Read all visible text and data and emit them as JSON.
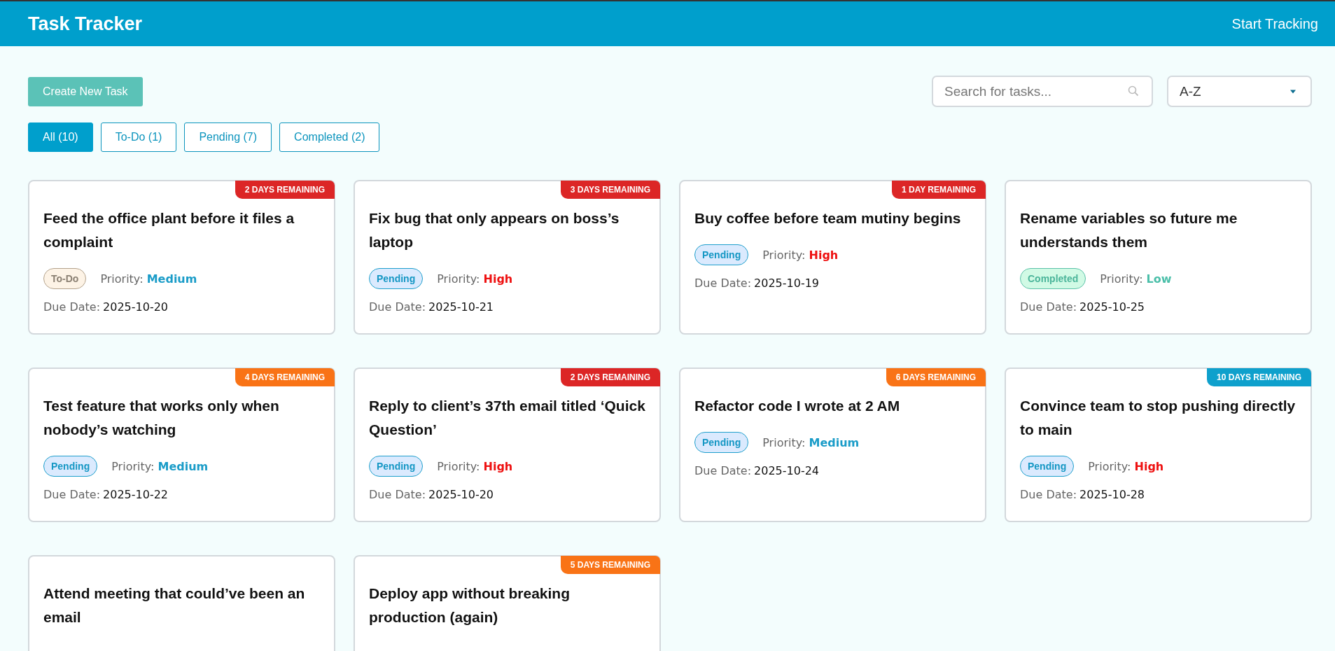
{
  "header": {
    "title": "Task Tracker",
    "link": "Start Tracking"
  },
  "toolbar": {
    "create_button": "Create New Task",
    "search": {
      "placeholder": "Search for tasks..."
    },
    "sort": {
      "value": "A-Z"
    }
  },
  "filters": [
    {
      "label": "All (10)",
      "selected": true
    },
    {
      "label": "To-Do (1)",
      "selected": false
    },
    {
      "label": "Pending (7)",
      "selected": false
    },
    {
      "label": "Completed (2)",
      "selected": false
    }
  ],
  "tasks": [
    {
      "title": "Feed the office plant before it files a complaint",
      "remaining": "2 DAYS REMAINING",
      "color": "#dc2626",
      "status": {
        "label": "To-Do",
        "kind": "todo"
      },
      "priority": {
        "label": "Priority:",
        "value": "Medium",
        "kind": "medium"
      },
      "due": {
        "label": "Due Date:",
        "value": "2025-10-20"
      }
    },
    {
      "title": "Fix bug that only appears on boss’s laptop",
      "remaining": "3 DAYS REMAINING",
      "color": "#dc2626",
      "status": {
        "label": "Pending",
        "kind": "pending"
      },
      "priority": {
        "label": "Priority:",
        "value": "High",
        "kind": "high"
      },
      "due": {
        "label": "Due Date:",
        "value": "2025-10-21"
      }
    },
    {
      "title": "Buy coffee before team mutiny begins",
      "remaining": "1 DAY REMAINING",
      "color": "#dc2626",
      "status": {
        "label": "Pending",
        "kind": "pending"
      },
      "priority": {
        "label": "Priority:",
        "value": "High",
        "kind": "high"
      },
      "due": {
        "label": "Due Date:",
        "value": "2025-10-19"
      }
    },
    {
      "title": "Rename variables so future me understands them",
      "status": {
        "label": "Completed",
        "kind": "completed"
      },
      "priority": {
        "label": "Priority:",
        "value": "Low",
        "kind": "low"
      },
      "due": {
        "label": "Due Date:",
        "value": "2025-10-25"
      }
    },
    {
      "title": "Test feature that works only when nobody’s watching",
      "remaining": "4 DAYS REMAINING",
      "color": "#f97316",
      "status": {
        "label": "Pending",
        "kind": "pending"
      },
      "priority": {
        "label": "Priority:",
        "value": "Medium",
        "kind": "medium"
      },
      "due": {
        "label": "Due Date:",
        "value": "2025-10-22"
      }
    },
    {
      "title": "Reply to client’s 37th email titled ‘Quick Question’",
      "remaining": "2 DAYS REMAINING",
      "color": "#dc2626",
      "status": {
        "label": "Pending",
        "kind": "pending"
      },
      "priority": {
        "label": "Priority:",
        "value": "High",
        "kind": "high"
      },
      "due": {
        "label": "Due Date:",
        "value": "2025-10-20"
      }
    },
    {
      "title": "Refactor code I wrote at 2 AM",
      "remaining": "6 DAYS REMAINING",
      "color": "#f97316",
      "status": {
        "label": "Pending",
        "kind": "pending"
      },
      "priority": {
        "label": "Priority:",
        "value": "Medium",
        "kind": "medium"
      },
      "due": {
        "label": "Due Date:",
        "value": "2025-10-24"
      }
    },
    {
      "title": "Convince team to stop pushing directly to main",
      "remaining": "10 DAYS REMAINING",
      "color": "#0ea0cc",
      "status": {
        "label": "Pending",
        "kind": "pending"
      },
      "priority": {
        "label": "Priority:",
        "value": "High",
        "kind": "high"
      },
      "due": {
        "label": "Due Date:",
        "value": "2025-10-28"
      }
    },
    {
      "title": "Attend meeting that could’ve been an email"
    },
    {
      "title": "Deploy app without breaking production (again)",
      "remaining": "5 DAYS REMAINING",
      "color": "#f97316"
    }
  ]
}
